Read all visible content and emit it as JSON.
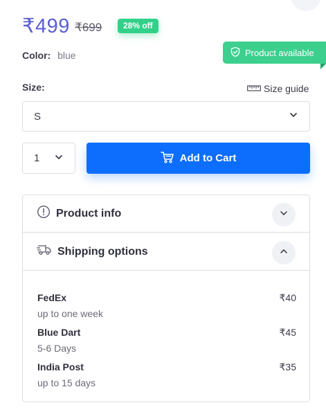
{
  "pricing": {
    "price": "₹499",
    "original_price": "₹699",
    "discount_badge": "28% off"
  },
  "color": {
    "label": "Color:",
    "value": "blue"
  },
  "availability": {
    "label": "Product available"
  },
  "size": {
    "label": "Size:",
    "guide_label": "Size guide",
    "selected": "S"
  },
  "quantity": {
    "selected": "1"
  },
  "cart": {
    "button_label": "Add to Cart"
  },
  "accordion": {
    "product_info_label": "Product info",
    "shipping_label": "Shipping options",
    "shipping_options": [
      {
        "carrier": "FedEx",
        "time": "up to one week",
        "price": "₹40"
      },
      {
        "carrier": "Blue Dart",
        "time": "5-6 Days",
        "price": "₹45"
      },
      {
        "carrier": "India Post",
        "time": "up to 15 days",
        "price": "₹35"
      }
    ]
  },
  "colors": {
    "accent": "#5a5fcf",
    "primary_button": "#0d6efd",
    "success": "#33d08a"
  },
  "icons": [
    "shield-check-icon",
    "ruler-icon",
    "chevron-down-icon",
    "cart-icon",
    "info-icon",
    "truck-icon",
    "chevron-up-icon"
  ]
}
